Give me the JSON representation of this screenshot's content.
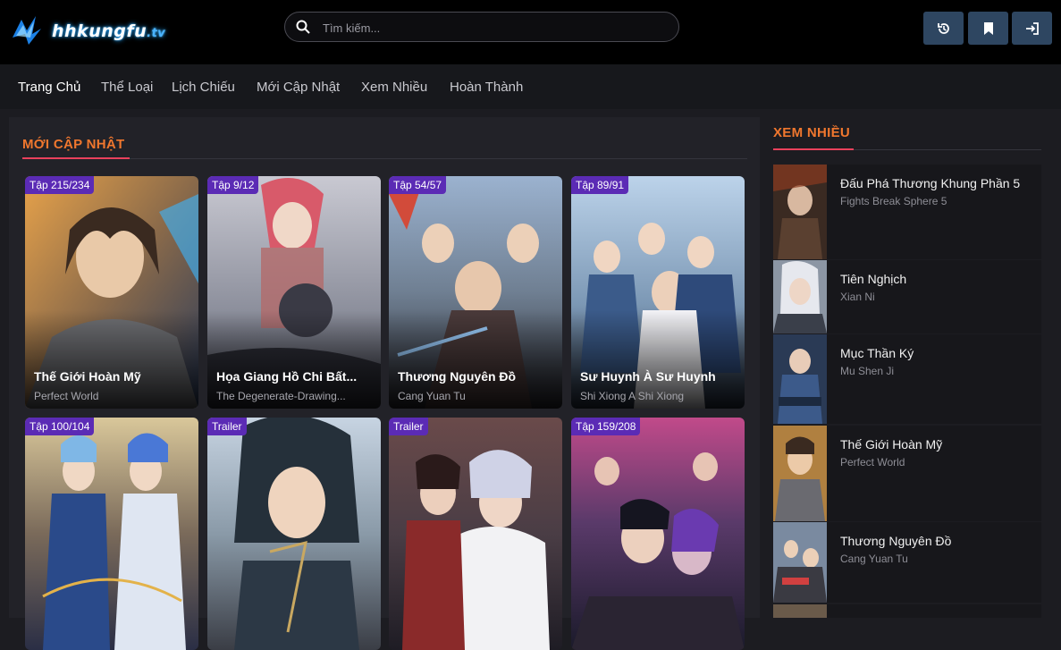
{
  "header": {
    "logo_main": "hhkungfu",
    "logo_tld": ".tv",
    "search_placeholder": "Tìm kiếm...",
    "buttons": [
      "history-icon",
      "bookmark-icon",
      "login-icon"
    ]
  },
  "nav": {
    "items": [
      "Trang Chủ",
      "Thể Loại",
      "Lịch Chiếu",
      "Mới Cập Nhật",
      "Xem Nhiều",
      "Hoàn Thành"
    ],
    "active": "Trang Chủ"
  },
  "main": {
    "section_title": "MỚI CẬP NHẬT",
    "cards": [
      {
        "badge": "Tập 215/234",
        "title": "Thế Giới Hoàn Mỹ",
        "subtitle": "Perfect World"
      },
      {
        "badge": "Tập 9/12",
        "title": "Họa Giang Hồ Chi Bất...",
        "subtitle": "The Degenerate-Drawing..."
      },
      {
        "badge": "Tập 54/57",
        "title": "Thương Nguyên Đồ",
        "subtitle": "Cang Yuan Tu"
      },
      {
        "badge": "Tập 89/91",
        "title": "Sư Huynh À Sư Huynh",
        "subtitle": "Shi Xiong A Shi Xiong"
      },
      {
        "badge": "Tập 100/104",
        "title": "",
        "subtitle": ""
      },
      {
        "badge": "Trailer",
        "title": "",
        "subtitle": ""
      },
      {
        "badge": "Trailer",
        "title": "",
        "subtitle": ""
      },
      {
        "badge": "Tập 159/208",
        "title": "",
        "subtitle": ""
      }
    ]
  },
  "sidebar": {
    "section_title": "XEM NHIỀU",
    "items": [
      {
        "title": "Đấu Phá Thương Khung Phần 5",
        "subtitle": "Fights Break Sphere 5"
      },
      {
        "title": "Tiên Nghịch",
        "subtitle": "Xian Ni"
      },
      {
        "title": "Mục Thần Ký",
        "subtitle": "Mu Shen Ji"
      },
      {
        "title": "Thế Giới Hoàn Mỹ",
        "subtitle": "Perfect World"
      },
      {
        "title": "Thương Nguyên Đồ",
        "subtitle": "Cang Yuan Tu"
      }
    ]
  },
  "colors": {
    "accent_orange": "#f0772e",
    "accent_pink": "#e9415c",
    "badge_purple": "#5b2bb5",
    "button_blue": "#2e4661"
  }
}
